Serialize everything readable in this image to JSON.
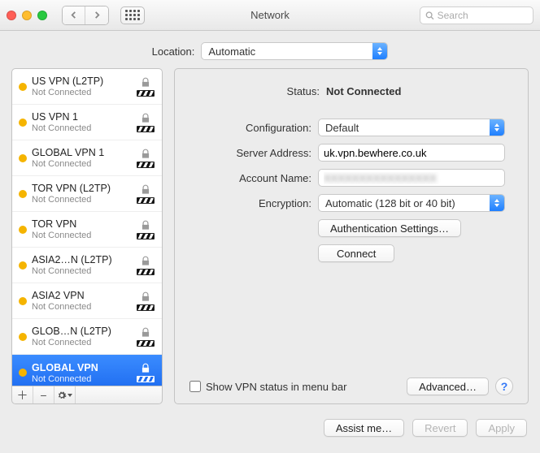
{
  "window_title": "Network",
  "search_placeholder": "Search",
  "location": {
    "label": "Location:",
    "value": "Automatic"
  },
  "sidebar": {
    "sub_not_connected": "Not Connected",
    "items": [
      {
        "name": "US VPN (L2TP)"
      },
      {
        "name": "US VPN 1"
      },
      {
        "name": "GLOBAL VPN 1"
      },
      {
        "name": "TOR VPN (L2TP)"
      },
      {
        "name": "TOR VPN"
      },
      {
        "name": "ASIA2…N (L2TP)"
      },
      {
        "name": "ASIA2 VPN"
      },
      {
        "name": "GLOB…N (L2TP)"
      },
      {
        "name": "GLOBAL VPN"
      }
    ]
  },
  "status": {
    "label": "Status:",
    "value": "Not Connected"
  },
  "config": {
    "label": "Configuration:",
    "value": "Default"
  },
  "server": {
    "label": "Server Address:",
    "value": "uk.vpn.bewhere.co.uk"
  },
  "account": {
    "label": "Account Name:",
    "value": "XXXXXXXXXXXXXXXX"
  },
  "encryption": {
    "label": "Encryption:",
    "value": "Automatic (128 bit or 40 bit)"
  },
  "buttons": {
    "auth": "Authentication Settings…",
    "connect": "Connect",
    "advanced": "Advanced…",
    "assist": "Assist me…",
    "revert": "Revert",
    "apply": "Apply"
  },
  "show_status_label": "Show VPN status in menu bar"
}
